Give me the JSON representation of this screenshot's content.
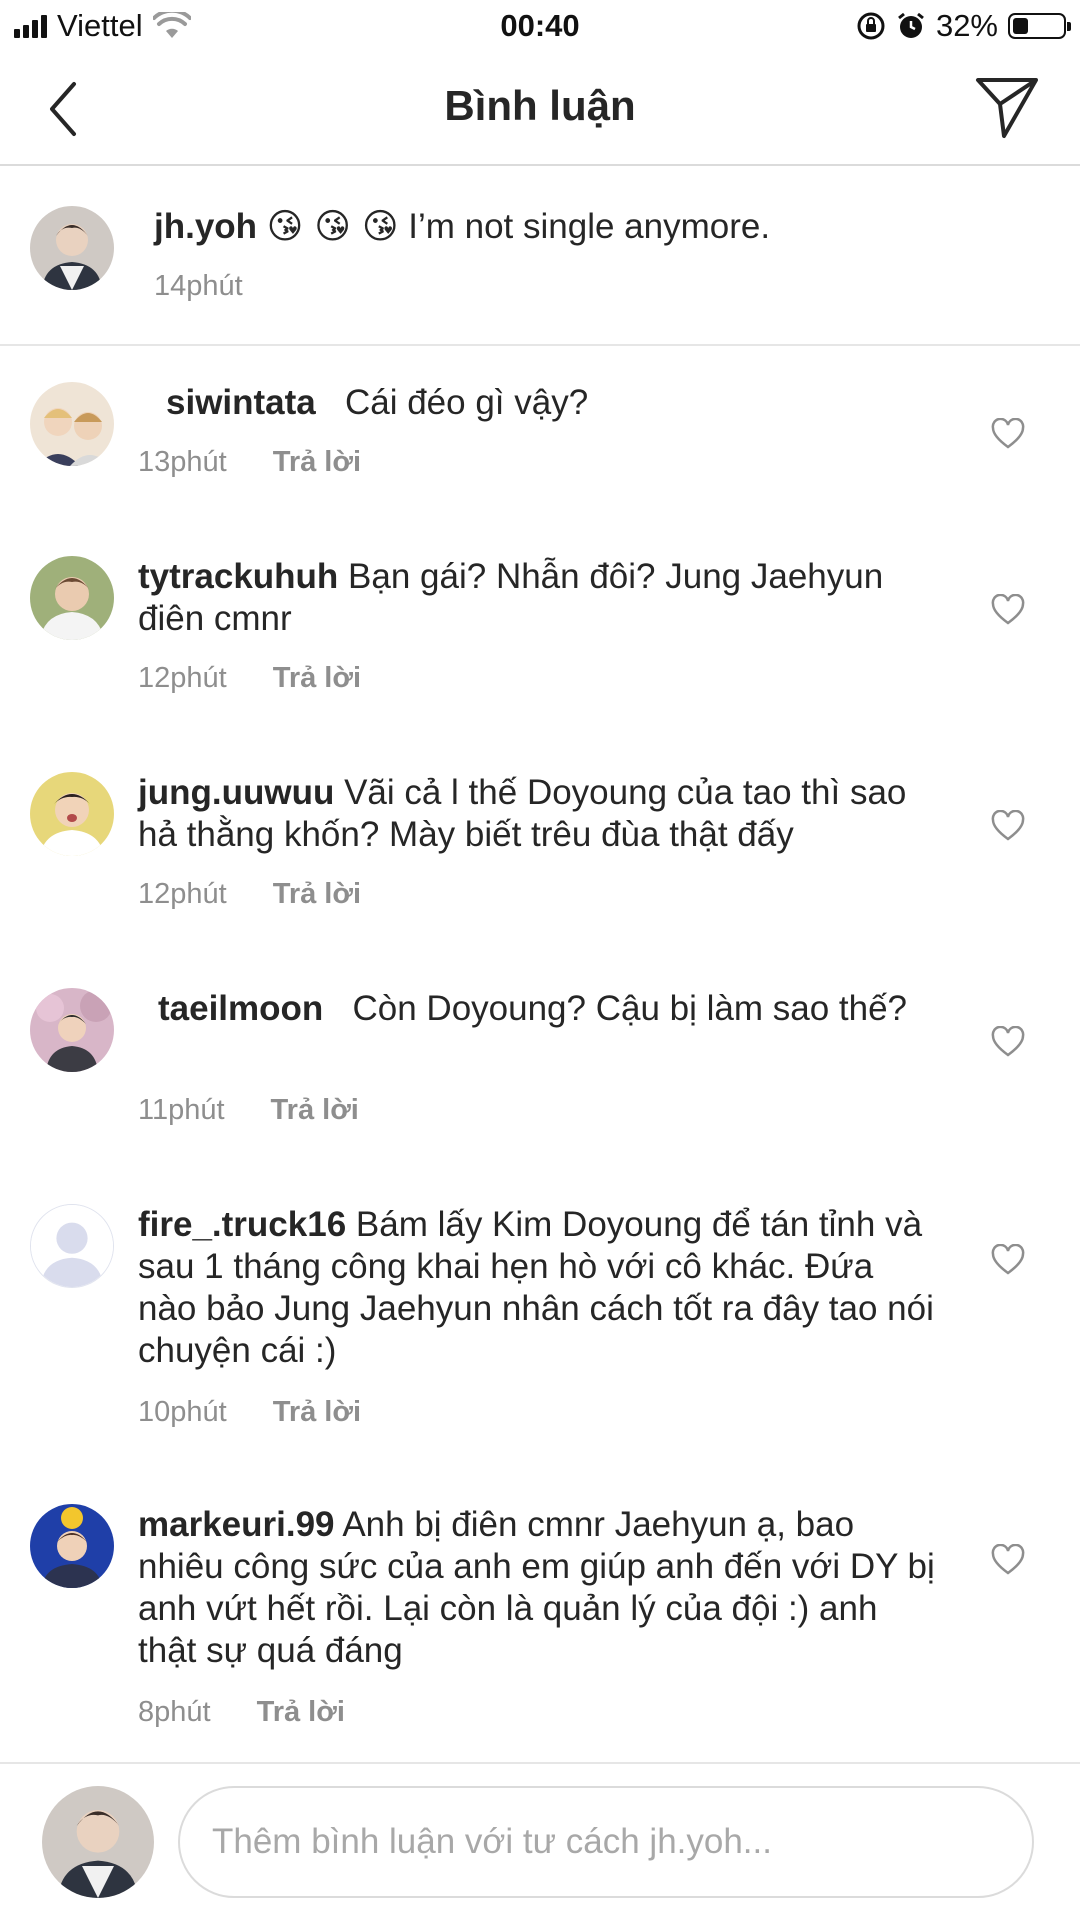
{
  "status_bar": {
    "carrier": "Viettel",
    "time": "00:40",
    "battery": "32%",
    "battery_level": 0.32
  },
  "header": {
    "title": "Bình luận",
    "back_icon": "chevron-left-icon",
    "share_icon": "send-icon"
  },
  "caption": {
    "username": "jh.yoh",
    "emoji": "😘 😘 😘",
    "text": "I’m not single anymore.",
    "time": "14phút"
  },
  "comments": [
    {
      "username": "siwintata",
      "text": "Cái đéo gì vậy?",
      "time": "13phút",
      "reply": "Trả lời"
    },
    {
      "username": "tytrackuhuh",
      "text": "Bạn gái? Nhẫn đôi? Jung Jaehyun điên cmnr",
      "time": "12phút",
      "reply": "Trả lời"
    },
    {
      "username": "jung.uuwuu",
      "text": "Vãi cả l thế Doyoung của tao thì sao hả thằng khốn? Mày biết trêu đùa thật đấy",
      "time": "12phút",
      "reply": "Trả lời"
    },
    {
      "username": "taeilmoon",
      "text": "Còn Doyoung? Cậu bị làm sao thế?",
      "time": "11phút",
      "reply": "Trả lời"
    },
    {
      "username": "fire_.truck16",
      "text": "Bám lấy Kim Doyoung để tán tỉnh và sau 1 tháng công khai hẹn hò với cô khác. Đứa nào bảo Jung Jaehyun nhân cách tốt ra đây tao nói chuyện cái :)",
      "time": "10phút",
      "reply": "Trả lời"
    },
    {
      "username": "markeuri.99",
      "text": "Anh bị điên cmnr Jaehyun ạ, bao nhiêu công sức của anh em giúp anh đến với DY bị anh vứt hết rồi. Lại còn là quản lý của đội :) anh thật sự quá đáng",
      "time": "8phút",
      "reply": "Trả lời"
    }
  ],
  "input": {
    "placeholder": "Thêm bình luận với tư cách jh.yoh..."
  },
  "colors": {
    "text": "#262626",
    "secondary": "#8e8e8e",
    "border": "#dbdbdb"
  }
}
